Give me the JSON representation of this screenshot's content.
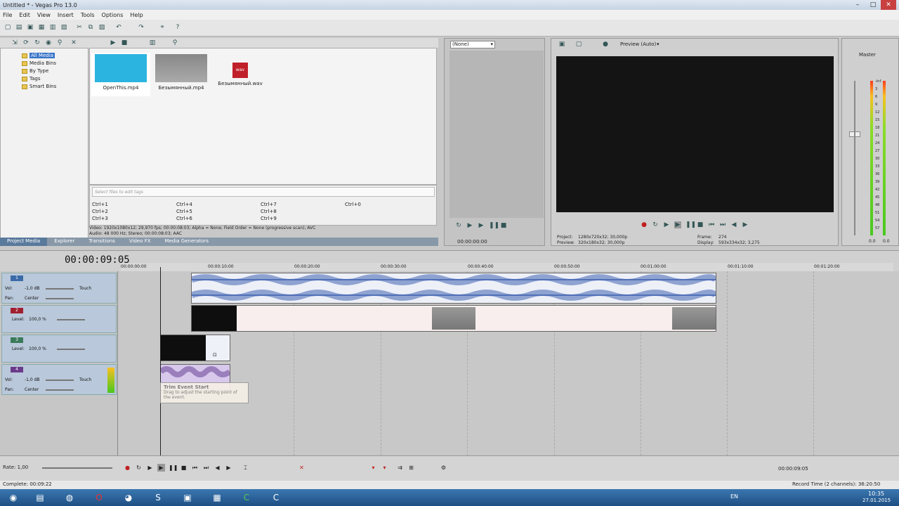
{
  "window": {
    "title": "Untitled * - Vegas Pro 13.0"
  },
  "menu": [
    "File",
    "Edit",
    "View",
    "Insert",
    "Tools",
    "Options",
    "Help"
  ],
  "explorer_tree": [
    "All Media",
    "Media Bins",
    "By Type",
    "Tags",
    "Smart Bins"
  ],
  "media_files": [
    {
      "name": "OpenThis.mp4",
      "color": "#2bb4e0"
    },
    {
      "name": "Безымянный.mp4",
      "color": "#8a8a8a"
    },
    {
      "name": "Безымянный.wav",
      "color": "#c0202a"
    }
  ],
  "tags": {
    "placeholder": "Select files to edit tags",
    "shortcuts": [
      "Ctrl+1",
      "Ctrl+2",
      "Ctrl+3",
      "Ctrl+4",
      "Ctrl+5",
      "Ctrl+6",
      "Ctrl+7",
      "Ctrl+8",
      "Ctrl+9",
      "Ctrl+0"
    ]
  },
  "media_info": {
    "video": "Video: 1920x1080x12; 29,970 fps; 00:00:08:03; Alpha = None; Field Order = None (progressive scan); AVC",
    "audio": "Audio: 48 000 Hz; Stereo; 00:00:08:03; AAC"
  },
  "panel_tabs": [
    "Project Media",
    "Explorer",
    "Transitions",
    "Video FX",
    "Media Generators"
  ],
  "trimmer": {
    "dropdown": "(None)",
    "time": "00:00:00:00"
  },
  "preview": {
    "mode": "Preview (Auto)",
    "project_label": "Project:",
    "project_value": "1280x720x32; 30,000p",
    "preview_label": "Preview:",
    "preview_value": "320x180x32; 30,000p",
    "frame_label": "Frame:",
    "frame_value": "274",
    "display_label": "Display:",
    "display_value": "593x334x32; 3,275"
  },
  "master": {
    "label": "Master",
    "scale": [
      "-Inf.",
      "3",
      "6",
      "9",
      "12",
      "15",
      "18",
      "21",
      "24",
      "27",
      "30",
      "33",
      "36",
      "39",
      "42",
      "45",
      "48",
      "51",
      "54",
      "57"
    ],
    "bottom_left": "0.0",
    "bottom_right": "0.0"
  },
  "timeline": {
    "timecode": "00:00:09:05",
    "ruler": [
      "00:00:00:00",
      "00:00:10:00",
      "00:00:20:00",
      "00:00:30:00",
      "00:00:40:00",
      "00:00:50:00",
      "00:01:00:00",
      "00:01:10:00",
      "00:01:20:00"
    ]
  },
  "tracks": [
    {
      "num": "1",
      "type": "audio",
      "vol_label": "Vol:",
      "vol": "-1,0 dB",
      "pan_label": "Pan:",
      "pan": "Center",
      "mode": "Touch",
      "color": "#3a6aa8"
    },
    {
      "num": "2",
      "type": "video",
      "level_label": "Level:",
      "level": "100,0 %",
      "color": "#a02030"
    },
    {
      "num": "3",
      "type": "video",
      "level_label": "Level:",
      "level": "100,0 %",
      "color": "#3a7a5a"
    },
    {
      "num": "4",
      "type": "audio",
      "vol_label": "Vol:",
      "vol": "-1,0 dB",
      "pan_label": "Pan:",
      "pan": "Center",
      "mode": "Touch",
      "color": "#6a3a8a"
    }
  ],
  "tooltip": {
    "title": "Trim Event Start",
    "body": "Drag to adjust the starting point of the event."
  },
  "rate": "Rate: 1,00",
  "transport_time": "00:00:09:05",
  "status": {
    "left": "Complete: 00:09:22",
    "right": "Record Time (2 channels): 36:20:50"
  },
  "tray": {
    "lang": "EN",
    "time": "10:35",
    "date": "27.01.2015"
  }
}
